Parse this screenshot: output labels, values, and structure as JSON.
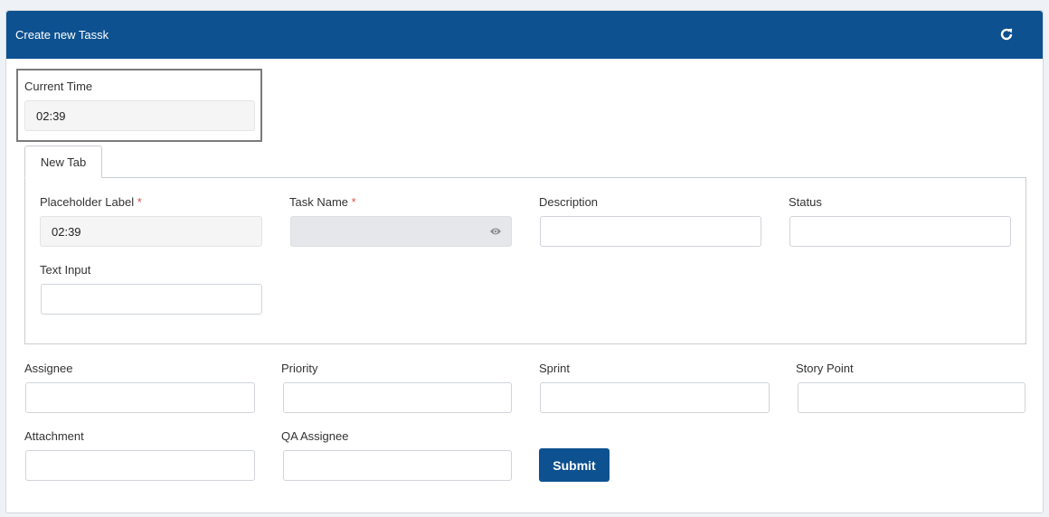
{
  "header": {
    "title": "Create new Tassk",
    "refresh_icon": "refresh-icon"
  },
  "current_time": {
    "label": "Current Time",
    "value": "02:39"
  },
  "tabs": [
    {
      "label": "New Tab"
    }
  ],
  "tab_fields": {
    "placeholder_label": {
      "label": "Placeholder Label",
      "required": "*",
      "value": "02:39"
    },
    "task_name": {
      "label": "Task Name",
      "required": "*",
      "value": "",
      "icon": "eye-icon"
    },
    "description": {
      "label": "Description",
      "value": ""
    },
    "status": {
      "label": "Status",
      "value": ""
    },
    "text_input": {
      "label": "Text Input",
      "value": ""
    }
  },
  "fields": {
    "assignee": {
      "label": "Assignee",
      "value": ""
    },
    "priority": {
      "label": "Priority",
      "value": ""
    },
    "sprint": {
      "label": "Sprint",
      "value": ""
    },
    "story_point": {
      "label": "Story Point",
      "value": ""
    },
    "attachment": {
      "label": "Attachment",
      "value": ""
    },
    "qa_assignee": {
      "label": "QA Assignee",
      "value": ""
    }
  },
  "submit_label": "Submit",
  "colors": {
    "primary": "#0d5190",
    "required": "#d9534f"
  }
}
